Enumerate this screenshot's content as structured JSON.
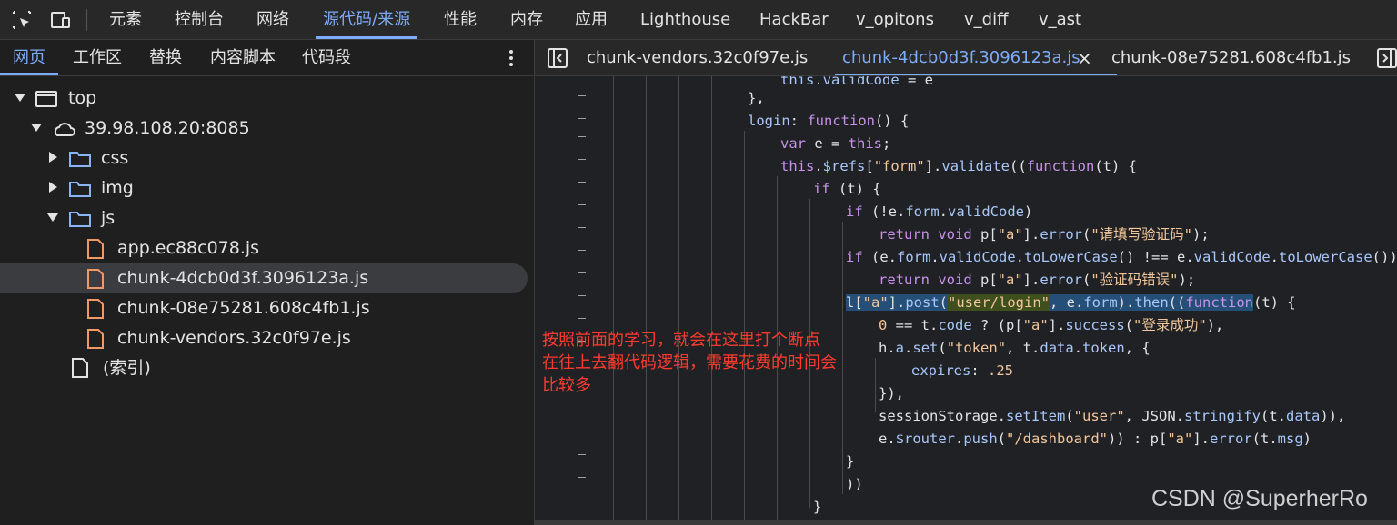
{
  "panel_tabs": [
    "元素",
    "控制台",
    "网络",
    "源代码/来源",
    "性能",
    "内存",
    "应用",
    "Lighthouse",
    "HackBar",
    "v_opitons",
    "v_diff",
    "v_ast"
  ],
  "active_panel": "源代码/来源",
  "navigator": {
    "tabs": [
      "网页",
      "工作区",
      "替换",
      "内容脚本",
      "代码段"
    ],
    "tree": [
      {
        "label": "top",
        "type": "frame"
      },
      {
        "label": "39.98.108.20:8085",
        "type": "cloud"
      },
      {
        "label": "css",
        "type": "folder"
      },
      {
        "label": "img",
        "type": "folder"
      },
      {
        "label": "js",
        "type": "folder"
      },
      {
        "label": "app.ec88c078.js",
        "type": "file"
      },
      {
        "label": "chunk-4dcb0d3f.3096123a.js",
        "type": "file",
        "selected": true
      },
      {
        "label": "chunk-08e75281.608c4fb1.js",
        "type": "file"
      },
      {
        "label": "chunk-vendors.32c0f97e.js",
        "type": "file"
      },
      {
        "label": "(索引)",
        "type": "doc"
      }
    ]
  },
  "editor": {
    "tabs": [
      "chunk-vendors.32c0f97e.js",
      "chunk-4dcb0d3f.3096123a.js",
      "chunk-08e75281.608c4fb1.js"
    ],
    "active_tab": "chunk-4dcb0d3f.3096123a.js",
    "close_glyph": "×"
  },
  "annotation": [
    "按照前面的学习，就会在这里打个断点",
    "在往上去翻代码逻辑，需要花费的时间会",
    "比较多"
  ],
  "watermark": "CSDN @SuperherRo",
  "colors": {
    "accent": "#7cacf8",
    "annotation": "#ff3b30",
    "selection": "#264f78"
  }
}
